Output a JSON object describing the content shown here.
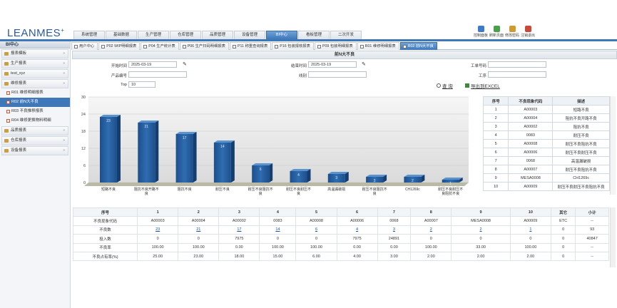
{
  "app": {
    "logo": "LEANMES",
    "logo_plus": "+",
    "nav": [
      "系统管理",
      "基础数据",
      "生产管理",
      "仓库管理",
      "品质管理",
      "设备管理",
      "BI中心",
      "看板管理",
      "二次开发"
    ],
    "nav_active_index": 6,
    "header_icons": [
      {
        "label": "控制面板",
        "icon": "panel-icon",
        "color": "#3b7bc8"
      },
      {
        "label": "刷新页面",
        "icon": "refresh-icon",
        "color": "#4aa04a"
      },
      {
        "label": "修改密码",
        "icon": "key-icon",
        "color": "#d09a30"
      },
      {
        "label": "注销退出",
        "icon": "logout-icon",
        "color": "#c84a3a"
      }
    ]
  },
  "sidebar": {
    "title": "BI中心",
    "groups": [
      {
        "label": "报表模板",
        "items": []
      },
      {
        "label": "生产报表",
        "items": []
      },
      {
        "label": "test_xyz",
        "items": []
      },
      {
        "label": "维修报表",
        "items": [
          "R01 维修明细报表",
          "R02 前N大不良",
          "R03 不良推移报表",
          "R04 维修更换物料明细"
        ]
      },
      {
        "label": "品质报表",
        "items": []
      },
      {
        "label": "仓库报表",
        "items": []
      },
      {
        "label": "设备报表",
        "items": []
      }
    ],
    "active_item": "R02 前N大不良"
  },
  "tabs": [
    "用户中心",
    "P02 WIP明细报表",
    "P04 生产统计表",
    "P06 生产扫码明细报表",
    "P11 称重查询报表",
    "P16 包装报核报表",
    "P09 包装明细报表",
    "R01 维修明细报表",
    "R02 前N大不良"
  ],
  "tab_active_index": 8,
  "page_title": "前N大不良",
  "filters": {
    "start_label": "开始时间",
    "start_value": "2025-03-19",
    "end_label": "结束时间",
    "end_value": "2025-03-19",
    "order_label": "工单号码",
    "order_value": "",
    "product_label": "产品编号",
    "product_value": "",
    "line_label": "线别",
    "line_value": "",
    "station_label": "工序",
    "station_value": "",
    "top_label": "Top",
    "top_value": "10",
    "query_button": "查 询",
    "export_button": "导出到EXCEL"
  },
  "chart_data": {
    "type": "bar",
    "categories": [
      "短路不良",
      "阻抗不良开路不良",
      "阻抗不良",
      "耐压不良",
      "耐压不良阻抗不良",
      "耐压不良耐压不良",
      "高温漏破损",
      "耐压不良阻抗不良",
      "CH1269c",
      "耐压不良耐压不良阻抗不良"
    ],
    "values": [
      23,
      21,
      17,
      14,
      6,
      4,
      3,
      2,
      2,
      1
    ],
    "ylim": [
      0,
      30
    ],
    "yticks": [
      0,
      6,
      12,
      18,
      24,
      30
    ],
    "bar_color": "#2f6db0"
  },
  "side_table": {
    "headers": [
      "序号",
      "不良现象代码",
      "描述"
    ],
    "rows": [
      [
        "1",
        "A00003",
        "短路不良"
      ],
      [
        "2",
        "A00004",
        "阻抗不良开路不良"
      ],
      [
        "3",
        "A00002",
        "阻抗不良"
      ],
      [
        "4",
        "0083",
        "耐压不良"
      ],
      [
        "5",
        "A00008",
        "耐压不良阻抗不良"
      ],
      [
        "6",
        "A00006",
        "耐压不良耐压不良"
      ],
      [
        "7",
        "0068",
        "高温漏破损"
      ],
      [
        "8",
        "A00007",
        "耐压不良阻抗不良"
      ],
      [
        "9",
        "MESA0008",
        "CH1269c"
      ],
      [
        "10",
        "A00009",
        "耐压不良耐压不良阻抗不良"
      ]
    ]
  },
  "bottom_table": {
    "headers": [
      "序号",
      "1",
      "2",
      "3",
      "4",
      "5",
      "6",
      "7",
      "8",
      "9",
      "10",
      "其它",
      "小计"
    ],
    "rows": [
      {
        "label": "不良现象代码",
        "cells": [
          "A00003",
          "A00004",
          "A00002",
          "0083",
          "A00008",
          "A00006",
          "0068",
          "A00007",
          "MESA0008",
          "A00009",
          "ETC",
          "--"
        ]
      },
      {
        "label": "不良数",
        "cells": [
          "23",
          "21",
          "17",
          "14",
          "6",
          "4",
          "3",
          "2",
          "2",
          "1",
          "0",
          "93"
        ],
        "link": true
      },
      {
        "label": "投入数",
        "cells": [
          "0",
          "0",
          "7975",
          "0",
          "0",
          "7975",
          "24891",
          "0",
          "0",
          "0",
          "0",
          "40847"
        ]
      },
      {
        "label": "不良率",
        "cells": [
          "100.00",
          "100.00",
          "0.00",
          "100.00",
          "100.00",
          "0.00",
          "0.00",
          "100.00",
          "33.00",
          "100.00",
          "0",
          "--"
        ]
      },
      {
        "label": "不良占有率(%)",
        "cells": [
          "25.00",
          "23.00",
          "18.00",
          "15.00",
          "6.00",
          "4.00",
          "3.00",
          "2.00",
          "2.00",
          "2.00",
          "0",
          "--"
        ]
      }
    ]
  }
}
